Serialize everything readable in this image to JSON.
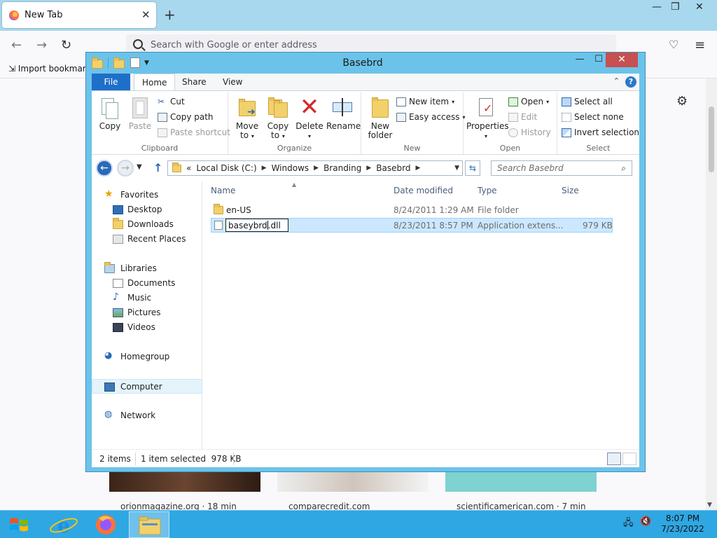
{
  "firefox": {
    "tab_title": "New Tab",
    "url_placeholder": "Search with Google or enter address",
    "bookmark_import": "Import bookmark",
    "cards": [
      {
        "text": "orionmagazine.org · 18 min"
      },
      {
        "text": "comparecredit.com"
      },
      {
        "text": "scientificamerican.com · 7 min"
      }
    ]
  },
  "explorer": {
    "title": "Basebrd",
    "ribbon_tabs": [
      "File",
      "Home",
      "Share",
      "View"
    ],
    "clipboard": {
      "label": "Clipboard",
      "copy": "Copy",
      "paste": "Paste",
      "cut": "Cut",
      "copy_path": "Copy path",
      "paste_shortcut": "Paste shortcut"
    },
    "organize": {
      "label": "Organize",
      "move_to_1": "Move",
      "move_to_2": "to",
      "copy_to_1": "Copy",
      "copy_to_2": "to",
      "delete": "Delete",
      "rename": "Rename"
    },
    "new": {
      "label": "New",
      "new_folder_1": "New",
      "new_folder_2": "folder",
      "new_item": "New item",
      "easy_access": "Easy access"
    },
    "open": {
      "label": "Open",
      "properties": "Properties",
      "open": "Open",
      "edit": "Edit",
      "history": "History"
    },
    "select": {
      "label": "Select",
      "select_all": "Select all",
      "select_none": "Select none",
      "invert": "Invert selection"
    },
    "address": {
      "prefix": "«",
      "crumbs": [
        "Local Disk (C:)",
        "Windows",
        "Branding",
        "Basebrd"
      ]
    },
    "search_placeholder": "Search Basebrd",
    "nav": {
      "favorites": "Favorites",
      "desktop": "Desktop",
      "downloads": "Downloads",
      "recent": "Recent Places",
      "libraries": "Libraries",
      "documents": "Documents",
      "music": "Music",
      "pictures": "Pictures",
      "videos": "Videos",
      "homegroup": "Homegroup",
      "computer": "Computer",
      "network": "Network"
    },
    "columns": {
      "name": "Name",
      "date": "Date modified",
      "type": "Type",
      "size": "Size"
    },
    "files": [
      {
        "name": "en-US",
        "date": "8/24/2011 1:29 AM",
        "type": "File folder",
        "size": ""
      },
      {
        "name_before_caret": "baseybrd",
        "name_after_caret": ".dll",
        "date": "8/23/2011 8:57 PM",
        "type": "Application extens...",
        "size": "979 KB"
      }
    ],
    "status": {
      "count": "2 items",
      "selected": "1 item selected  978 KB"
    }
  },
  "taskbar": {
    "time": "8:07 PM",
    "date": "7/23/2022"
  }
}
